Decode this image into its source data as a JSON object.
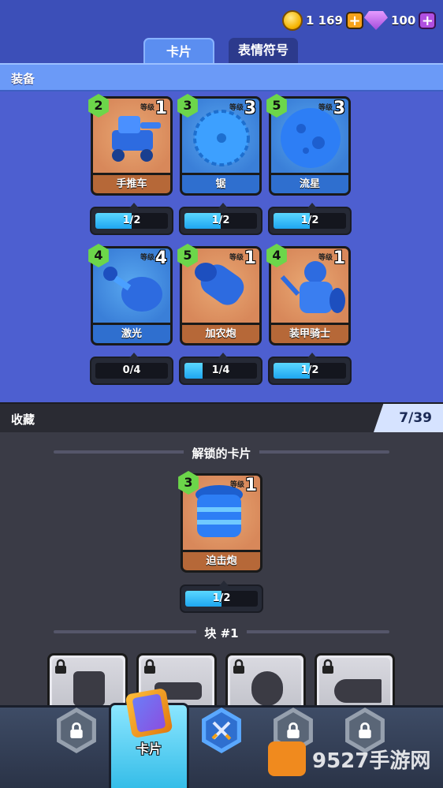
{
  "currency": {
    "coins": "1 169",
    "gems": "100",
    "plus": "+"
  },
  "tabs": [
    {
      "label": "卡片"
    },
    {
      "label": "表情符号"
    }
  ],
  "equipment": {
    "title": "装备",
    "level_label": "等级"
  },
  "cards": [
    {
      "name": "手推车",
      "cost": "2",
      "level": "1",
      "progress": "1/2",
      "fill": 0.5,
      "style": "orange"
    },
    {
      "name": "锯",
      "cost": "3",
      "level": "3",
      "progress": "1/2",
      "fill": 0.5,
      "style": "blue"
    },
    {
      "name": "流星",
      "cost": "5",
      "level": "3",
      "progress": "1/2",
      "fill": 0.5,
      "style": "blue"
    },
    {
      "name": "激光",
      "cost": "4",
      "level": "4",
      "progress": "0/4",
      "fill": 0,
      "style": "blue"
    },
    {
      "name": "加农炮",
      "cost": "5",
      "level": "1",
      "progress": "1/4",
      "fill": 0.25,
      "style": "orange"
    },
    {
      "name": "装甲骑士",
      "cost": "4",
      "level": "1",
      "progress": "1/2",
      "fill": 0.5,
      "style": "orange"
    }
  ],
  "collection": {
    "title": "收藏",
    "count": "7/39",
    "unlocked_title": "解锁的卡片",
    "unlocked_card": {
      "name": "迫击炮",
      "cost": "3",
      "level": "1",
      "progress": "1/2",
      "fill": 0.5
    },
    "block_title": "块 #1"
  },
  "nav": {
    "cards_label": "卡片"
  },
  "watermark": {
    "text": "9527手游网"
  }
}
